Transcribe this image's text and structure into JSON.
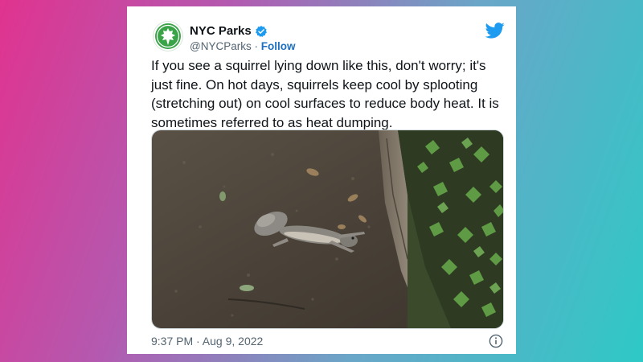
{
  "tweet": {
    "display_name": "NYC Parks",
    "handle": "@NYCParks",
    "separator": "·",
    "follow_label": "Follow",
    "text": "If you see a squirrel lying down like this, don't worry; it's just fine. On hot days, squirrels keep cool by splooting (stretching out) on cool surfaces to reduce body heat. It is sometimes referred to as heat dumping.",
    "timestamp": "9:37 PM · Aug 9, 2022",
    "media_subject": "squirrel splooting on dirt beside a log and ground ivy"
  },
  "icons": {
    "avatar": "nyc-parks-leaf-logo",
    "verified": "verified-badge-icon",
    "brand": "twitter-bird-icon",
    "info": "info-icon"
  },
  "colors": {
    "brand_blue": "#1d9bf0",
    "parks_green": "#3aa347",
    "text": "#0f1419",
    "muted": "#536471"
  }
}
